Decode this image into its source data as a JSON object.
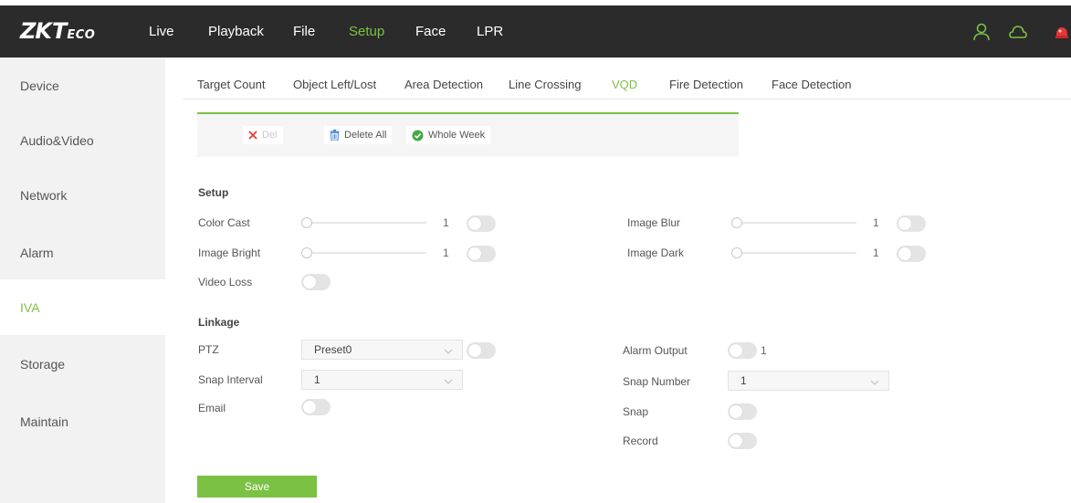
{
  "colors": {
    "accent": "#7bc143",
    "topbar": "#2b2b2b",
    "sidebar_bg": "#f2f2f2",
    "alert": "#e53935"
  },
  "header": {
    "logo": {
      "main": "ZK",
      "t": "T",
      "eco": "ECO"
    },
    "nav": [
      {
        "label": "Live"
      },
      {
        "label": "Playback"
      },
      {
        "label": "File"
      },
      {
        "label": "Setup"
      },
      {
        "label": "Face"
      },
      {
        "label": "LPR"
      }
    ],
    "active_nav": "Setup",
    "icons": [
      "user-icon",
      "cloud-icon",
      "alarm-light-icon"
    ]
  },
  "sidebar": {
    "items": [
      {
        "label": "Device"
      },
      {
        "label": "Audio&Video"
      },
      {
        "label": "Network"
      },
      {
        "label": "Alarm"
      },
      {
        "label": "IVA"
      },
      {
        "label": "Storage"
      },
      {
        "label": "Maintain"
      }
    ],
    "active": "IVA"
  },
  "tabs": {
    "items": [
      {
        "label": "Target Count"
      },
      {
        "label": "Object Left/Lost"
      },
      {
        "label": "Area Detection"
      },
      {
        "label": "Line Crossing"
      },
      {
        "label": "VQD"
      },
      {
        "label": "Fire Detection"
      },
      {
        "label": "Face Detection"
      }
    ],
    "active": "VQD"
  },
  "schedule": {
    "del_label": "Del",
    "delete_all_label": "Delete All",
    "whole_week_label": "Whole Week"
  },
  "setup": {
    "title": "Setup",
    "color_cast": {
      "label": "Color Cast",
      "value": "1"
    },
    "image_blur": {
      "label": "Image Blur",
      "value": "1"
    },
    "image_bright": {
      "label": "Image Bright",
      "value": "1"
    },
    "image_dark": {
      "label": "Image Dark",
      "value": "1"
    },
    "video_loss": {
      "label": "Video Loss"
    }
  },
  "linkage": {
    "title": "Linkage",
    "ptz": {
      "label": "PTZ",
      "value": "Preset0"
    },
    "snap_interval": {
      "label": "Snap Interval",
      "value": "1"
    },
    "email": {
      "label": "Email"
    },
    "alarm_output": {
      "label": "Alarm Output",
      "value": "1"
    },
    "snap_number": {
      "label": "Snap Number",
      "value": "1"
    },
    "snap": {
      "label": "Snap"
    },
    "record": {
      "label": "Record"
    }
  },
  "save_label": "Save"
}
